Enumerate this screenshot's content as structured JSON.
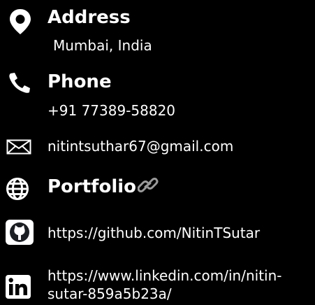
{
  "address": {
    "title": "Address",
    "value": "Mumbai, India",
    "icon": "location-pin-icon"
  },
  "phone": {
    "title": "Phone",
    "value": "+91 77389-58820",
    "icon": "phone-icon"
  },
  "email": {
    "value": "nitintsuthar67@gmail.com",
    "icon": "mail-icon"
  },
  "portfolio": {
    "title": "Portfolio",
    "icon": "globe-icon",
    "link_icon": "link-icon"
  },
  "github": {
    "url": "https://github.com/NitinTSutar",
    "icon": "github-icon"
  },
  "linkedin": {
    "url_line1": "https://www.linkedin.com/in/nitin-",
    "url_line2": "sutar-859a5b23a/",
    "icon": "linkedin-icon"
  }
}
